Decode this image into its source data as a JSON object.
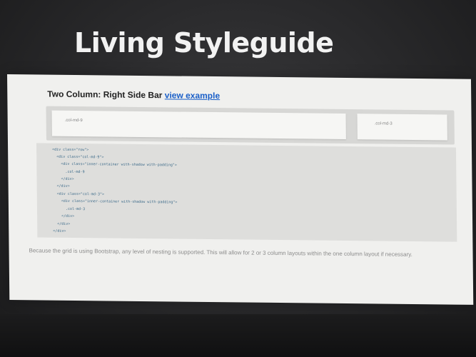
{
  "slide": {
    "title": "Living Styleguide"
  },
  "section": {
    "heading": "Two Column: Right Side Bar",
    "link_label": "view example"
  },
  "grid_demo": {
    "main_col_label": ".col-md-9",
    "side_col_label": ".col-md-3"
  },
  "code_lines": [
    "<div class=\"row\">",
    "  <div class=\"col-md-9\">",
    "    <div class=\"inner-container with-shadow with-padding\">",
    "      .col-md-9",
    "    </div>",
    "  </div>",
    "  <div class=\"col-md-3\">",
    "    <div class=\"inner-container with-shadow with-padding\">",
    "      .col-md-3",
    "    </div>",
    "  </div>",
    "</div>"
  ],
  "caption": "Because the grid is using Bootstrap, any level of nesting is supported. This will allow for 2 or 3 column layouts within the one column layout if necessary."
}
